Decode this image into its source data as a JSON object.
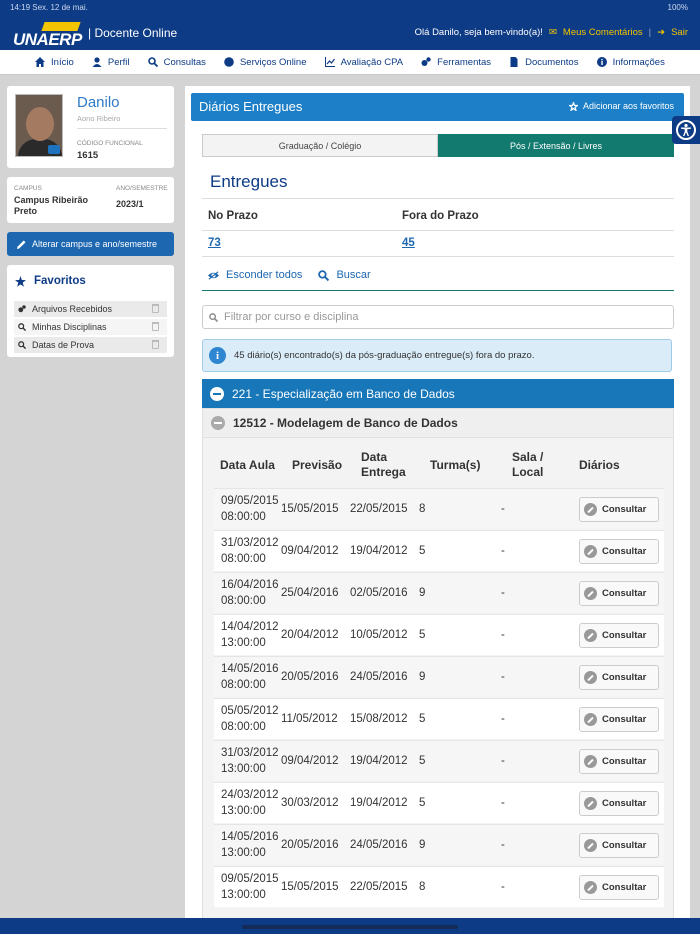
{
  "status": {
    "time_date": "14:19  Sex. 12 de mai.",
    "battery": "100%"
  },
  "header": {
    "logo": "UNAERP",
    "app_title": "| Docente Online",
    "greeting": "Olá Danilo, seja bem-vindo(a)!",
    "comments": "Meus Comentários",
    "separator": "|",
    "logout": "Sair"
  },
  "nav": [
    "Início",
    "Perfil",
    "Consultas",
    "Serviços Online",
    "Avaliação CPA",
    "Ferramentas",
    "Documentos",
    "Informações"
  ],
  "profile": {
    "name": "Danilo",
    "subtitle": "Aono Ribeiro",
    "code_label": "CÓDIGO FUNCIONAL",
    "code": "1615"
  },
  "campus": {
    "campus_label": "CAMPUS",
    "campus_value": "Campus Ribeirão Preto",
    "year_label": "ANO/SEMESTRE",
    "year_value": "2023/1"
  },
  "change_button": "Alterar campus e ano/semestre",
  "favorites": {
    "title": "Favoritos",
    "items": [
      "Arquivos Recebidos",
      "Minhas Disciplinas",
      "Datas de Prova"
    ]
  },
  "main": {
    "title": "Diários Entregues",
    "add_fav": "Adicionar aos favoritos",
    "tabs": [
      "Graduação / Colégio",
      "Pós / Extensão / Livres"
    ],
    "section_title": "Entregues",
    "on_time_label": "No Prazo",
    "late_label": "Fora do Prazo",
    "on_time_value": "73",
    "late_value": "45",
    "hide_all": "Esconder todos",
    "search": "Buscar",
    "filter_placeholder": "Filtrar por curso e disciplina",
    "alert": "45 diário(s) encontrado(s) da pós-graduação entregue(s) fora do prazo.",
    "course": "221 - Especialização em Banco de Dados",
    "discipline": "12512 - Modelagem de Banco de Dados"
  },
  "table": {
    "headers": [
      "Data Aula",
      "Previsão",
      "Data Entrega",
      "Turma(s)",
      "Sala / Local",
      "Diários"
    ],
    "button_label": "Consultar",
    "rows": [
      {
        "date": "09/05/2015",
        "time": "08:00:00",
        "forecast": "15/05/2015",
        "delivery": "22/05/2015",
        "class": "8",
        "room": "-"
      },
      {
        "date": "31/03/2012",
        "time": "08:00:00",
        "forecast": "09/04/2012",
        "delivery": "19/04/2012",
        "class": "5",
        "room": "-"
      },
      {
        "date": "16/04/2016",
        "time": "08:00:00",
        "forecast": "25/04/2016",
        "delivery": "02/05/2016",
        "class": "9",
        "room": "-"
      },
      {
        "date": "14/04/2012",
        "time": "13:00:00",
        "forecast": "20/04/2012",
        "delivery": "10/05/2012",
        "class": "5",
        "room": "-"
      },
      {
        "date": "14/05/2016",
        "time": "08:00:00",
        "forecast": "20/05/2016",
        "delivery": "24/05/2016",
        "class": "9",
        "room": "-"
      },
      {
        "date": "05/05/2012",
        "time": "08:00:00",
        "forecast": "11/05/2012",
        "delivery": "15/08/2012",
        "class": "5",
        "room": "-"
      },
      {
        "date": "31/03/2012",
        "time": "13:00:00",
        "forecast": "09/04/2012",
        "delivery": "19/04/2012",
        "class": "5",
        "room": "-"
      },
      {
        "date": "24/03/2012",
        "time": "13:00:00",
        "forecast": "30/03/2012",
        "delivery": "19/04/2012",
        "class": "5",
        "room": "-"
      },
      {
        "date": "14/05/2016",
        "time": "13:00:00",
        "forecast": "20/05/2016",
        "delivery": "24/05/2016",
        "class": "9",
        "room": "-"
      },
      {
        "date": "09/05/2015",
        "time": "13:00:00",
        "forecast": "15/05/2015",
        "delivery": "22/05/2015",
        "class": "8",
        "room": "-"
      }
    ]
  }
}
